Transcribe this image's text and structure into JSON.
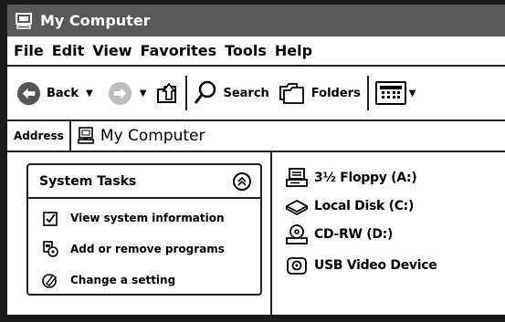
{
  "window": {
    "title": "My Computer",
    "title_icon": "my-computer-icon"
  },
  "menu": {
    "items": [
      "File",
      "Edit",
      "View",
      "Favorites",
      "Tools",
      "Help"
    ]
  },
  "toolbar": {
    "back_label": "Back",
    "search_label": "Search",
    "folders_label": "Folders"
  },
  "address": {
    "label": "Address",
    "value": "My Computer"
  },
  "system_tasks": {
    "title": "System Tasks",
    "items": [
      {
        "label": "View system information",
        "icon": "system-info-icon"
      },
      {
        "label": "Add or remove programs",
        "icon": "add-remove-programs-icon"
      },
      {
        "label": "Change a setting",
        "icon": "control-panel-icon"
      }
    ]
  },
  "drives": [
    {
      "label": "3½ Floppy (A:)",
      "icon": "floppy-drive-icon"
    },
    {
      "label": "Local Disk (C:)",
      "icon": "hard-disk-icon"
    },
    {
      "label": "CD-RW (D:)",
      "icon": "cd-drive-icon"
    },
    {
      "label": "USB Video Device",
      "icon": "webcam-icon"
    }
  ],
  "colors": {
    "titlebar": "#585858",
    "border": "#1a1a1a"
  }
}
